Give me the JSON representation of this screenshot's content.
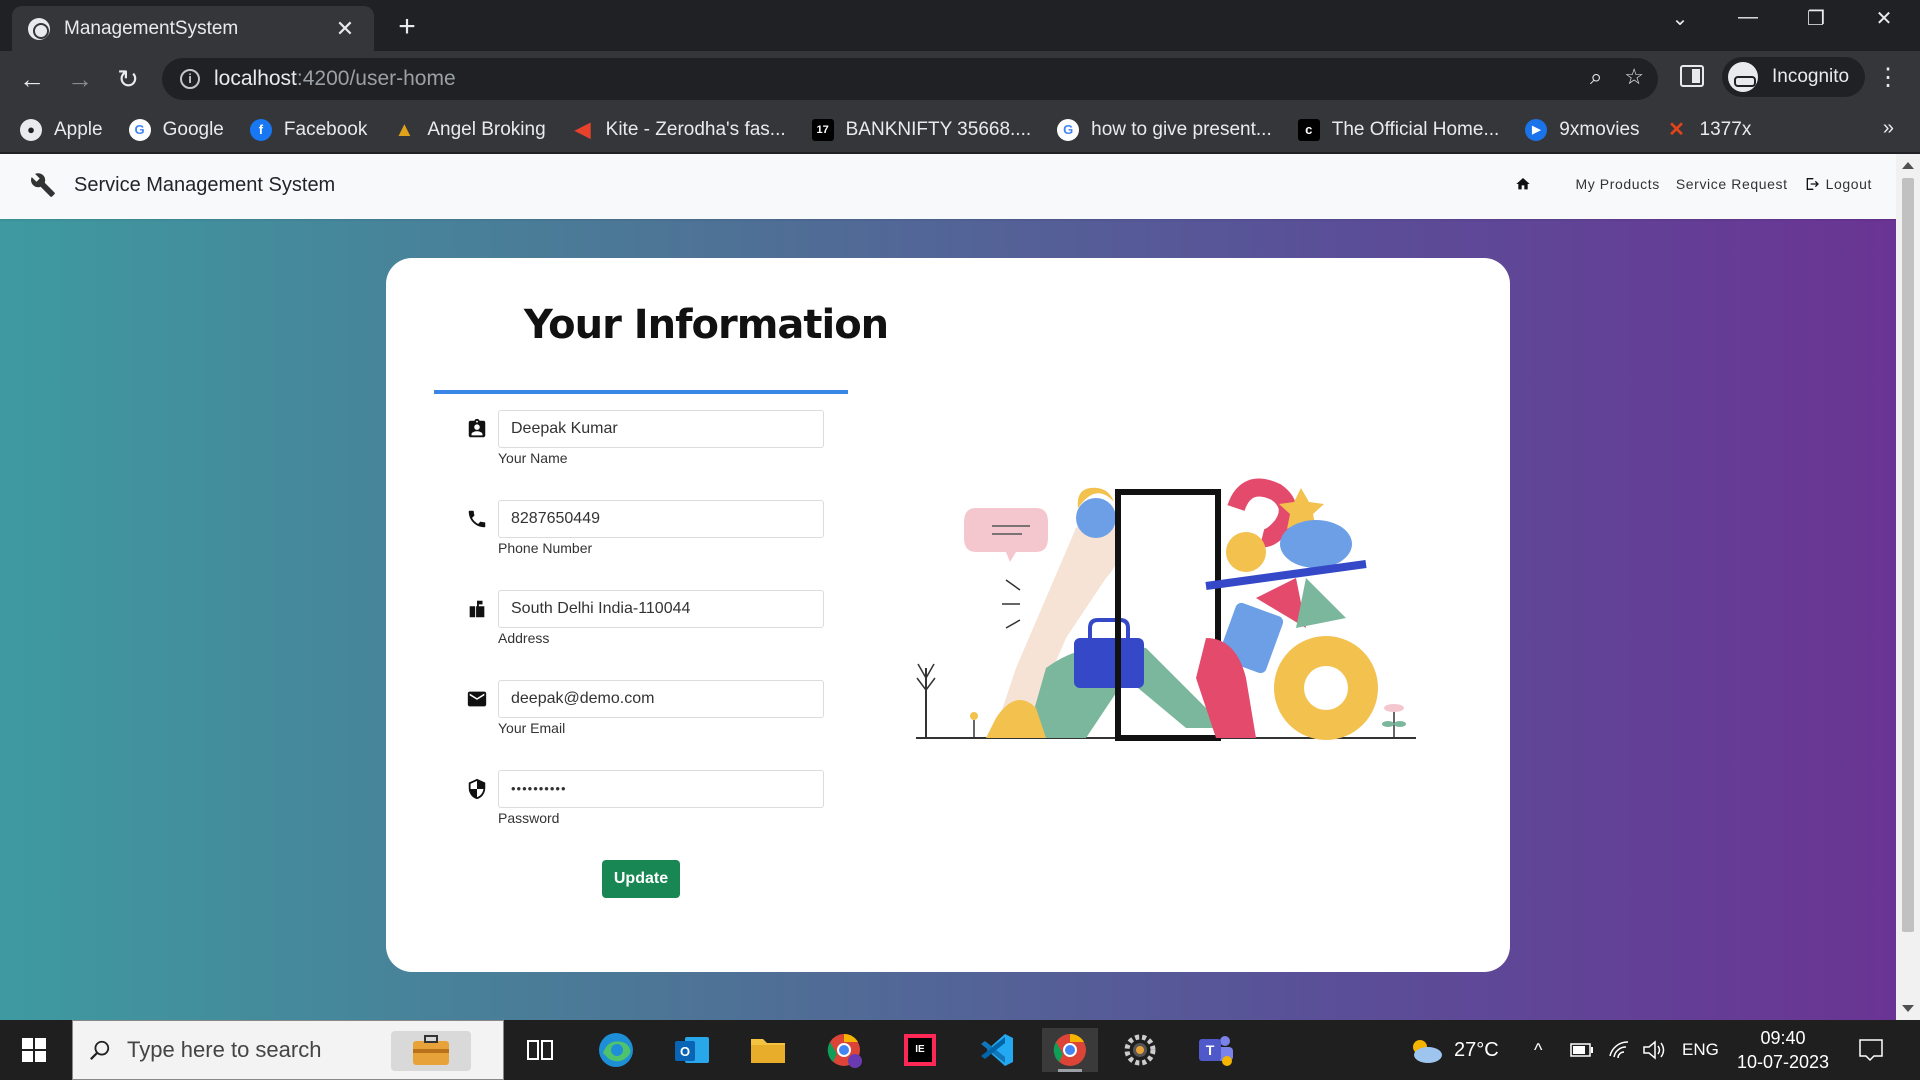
{
  "browser": {
    "tab_title": "ManagementSystem",
    "tab_close": "✕",
    "new_tab": "+",
    "url_host": "localhost",
    "url_path": ":4200/user-home",
    "profile_label": "Incognito",
    "bookmarks": [
      {
        "label": "Apple",
        "icon": "apple-icon",
        "color": "#e8eaed"
      },
      {
        "label": "Google",
        "icon": "google-icon",
        "color": "#4285f4"
      },
      {
        "label": "Facebook",
        "icon": "facebook-icon",
        "color": "#1877f2"
      },
      {
        "label": "Angel Broking",
        "icon": "angel-broking-icon",
        "color": "#e0a21a"
      },
      {
        "label": "Kite - Zerodha's fas...",
        "icon": "kite-icon",
        "color": "#e8412c"
      },
      {
        "label": "BANKNIFTY 35668....",
        "icon": "tradingview-icon",
        "color": "#000000"
      },
      {
        "label": "how to give present...",
        "icon": "google-icon",
        "color": "#4285f4"
      },
      {
        "label": "The Official Home...",
        "icon": "c-icon",
        "color": "#000000"
      },
      {
        "label": "9xmovies",
        "icon": "play-icon",
        "color": "#1a73e8"
      },
      {
        "label": "1377x",
        "icon": "x-icon",
        "color": "#e0441a"
      }
    ],
    "more_bookmarks": "»"
  },
  "app": {
    "brand": "Service Management System",
    "nav": {
      "my_products": "My Products",
      "service_request": "Service Request",
      "logout": "Logout"
    }
  },
  "form": {
    "title": "Your Information",
    "fields": [
      {
        "label": "Your Name",
        "value": "Deepak Kumar",
        "icon": "contact-card-icon"
      },
      {
        "label": "Phone Number",
        "value": "8287650449",
        "icon": "phone-icon"
      },
      {
        "label": "Address",
        "value": "South Delhi India-110044",
        "icon": "mailbox-icon"
      },
      {
        "label": "Your Email",
        "value": "deepak@demo.com",
        "icon": "envelope-icon"
      },
      {
        "label": "Password",
        "value": "••••••••••",
        "icon": "shield-icon"
      }
    ],
    "submit_label": "Update"
  },
  "taskbar": {
    "search_placeholder": "Type here to search",
    "weather": "27°C",
    "language": "ENG",
    "time": "09:40",
    "date": "10-07-2023"
  },
  "colors": {
    "accent_line": "#3a86e8",
    "button": "#198754",
    "page_gradient_start": "#3e9aa0",
    "page_gradient_end": "#6a3494"
  }
}
